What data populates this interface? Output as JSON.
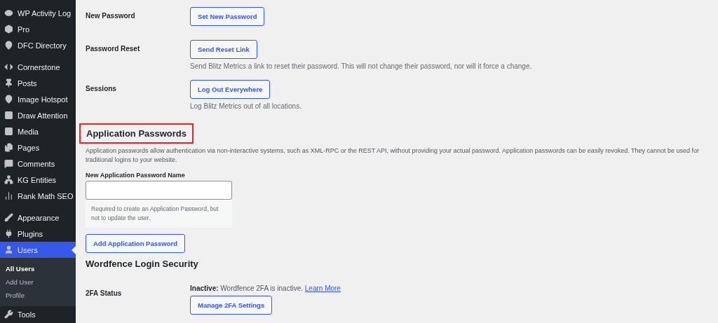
{
  "sidebar": {
    "groups": [
      {
        "items": [
          {
            "label": "WP Activity Log",
            "selected": false
          },
          {
            "label": "Pro",
            "selected": false
          },
          {
            "label": "DFC Directory",
            "selected": false
          }
        ]
      },
      {
        "items": [
          {
            "label": "Cornerstone",
            "selected": false
          },
          {
            "label": "Posts",
            "selected": false
          },
          {
            "label": "Image Hotspot",
            "selected": false
          },
          {
            "label": "Draw Attention",
            "selected": false
          },
          {
            "label": "Media",
            "selected": false
          },
          {
            "label": "Pages",
            "selected": false
          },
          {
            "label": "Comments",
            "selected": false
          },
          {
            "label": "KG Entities",
            "selected": false
          },
          {
            "label": "Rank Math SEO",
            "selected": false
          }
        ]
      },
      {
        "items": [
          {
            "label": "Appearance",
            "selected": false
          },
          {
            "label": "Plugins",
            "selected": false
          },
          {
            "label": "Users",
            "selected": true,
            "children": [
              {
                "label": "All Users",
                "selected": true
              },
              {
                "label": "Add User",
                "selected": false
              },
              {
                "label": "Profile",
                "selected": false
              }
            ]
          },
          {
            "label": "Tools",
            "selected": false
          }
        ]
      }
    ]
  },
  "rows": [
    {
      "label": "New Password",
      "button": "Set New Password"
    },
    {
      "label": "Password Reset",
      "button": "Send Reset Link",
      "description": "Send Blitz Metrics a link to reset their password. This will not change their password, nor will it force a change."
    },
    {
      "label": "Sessions",
      "button": "Log Out Everywhere",
      "description": "Log Blitz Metrics out of all locations."
    }
  ],
  "application_passwords": {
    "heading": "Application Passwords",
    "highlighted": true,
    "description": "Application passwords allow authentication via non-interactive systems, such as XML-RPC or the REST API, without providing your actual password. Application passwords can be easily revoked. They cannot be used for traditional logins to your website.",
    "field_label": "New Application Password Name",
    "field_hint": "Required to create an Application Password, but not to update the user.",
    "button": "Add Application Password"
  },
  "wordfence": {
    "heading": "Wordfence Login Security",
    "label": "2FA Status",
    "status": "Inactive:",
    "status_text": "Wordfence 2FA is inactive.",
    "link": "Learn More",
    "button": "Manage 2FA Settings"
  }
}
